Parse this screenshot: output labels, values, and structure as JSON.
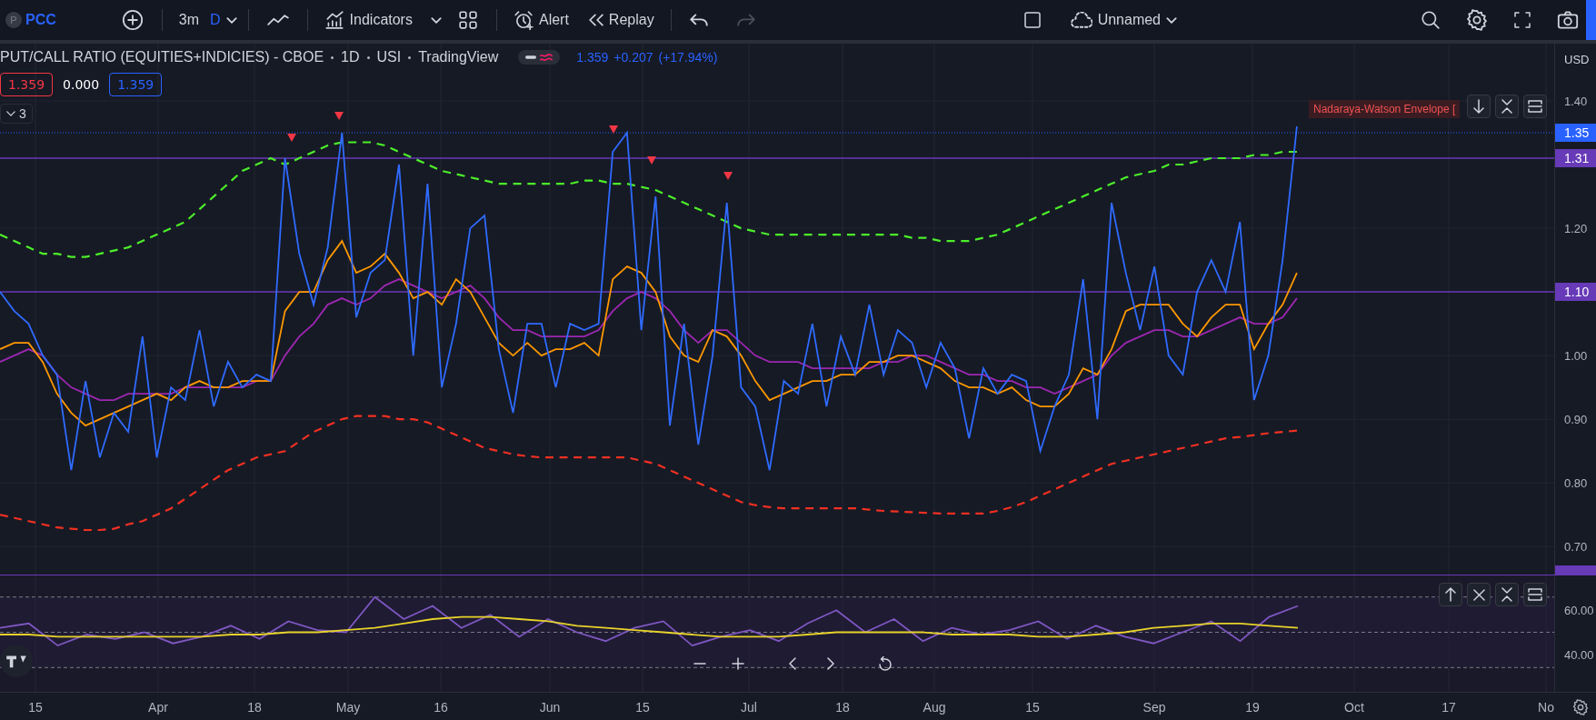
{
  "toolbar": {
    "symbol_initial": "P",
    "symbol": "PCC",
    "interval": "3m",
    "interval_unit": "D",
    "indicators": "Indicators",
    "alert": "Alert",
    "replay": "Replay",
    "redo_disabled": true,
    "layout_name": "Unnamed"
  },
  "legend": {
    "title": "PUT/CALL RATIO (EQUITIES+INDICIES) - CBOE",
    "interval": "1D",
    "exchange": "USI",
    "source": "TradingView",
    "visible": true,
    "last": "1.359",
    "change": "+0.207",
    "change_percent": "(+17.94%)",
    "values": [
      {
        "text": "1.359",
        "color": "#f23645"
      },
      {
        "text": "0.000"
      },
      {
        "text": "1.359",
        "color": "#2962ff"
      }
    ],
    "collapse_count": "3"
  },
  "indicator_label": "Nadaraya-Watson Envelope [",
  "axis_currency": "USD",
  "time_axis": [
    "15",
    "Apr",
    "18",
    "May",
    "16",
    "Jun",
    "15",
    "Jul",
    "18",
    "Aug",
    "15",
    "Sep",
    "19",
    "Oct",
    "17",
    "No"
  ],
  "main": {
    "signal_markers": [
      {
        "kind": "triangle"
      },
      {
        "kind": "triangle"
      },
      {
        "kind": "triangle"
      },
      {
        "kind": "triangle"
      },
      {
        "kind": "triangle"
      }
    ],
    "chart_data": {
      "type": "line",
      "grid": true,
      "ylim": [
        0.656,
        1.49
      ],
      "yticks": [
        {
          "value": 1.4,
          "label": "1.40"
        },
        {
          "value": 1.2,
          "label": "1.20"
        },
        {
          "value": 1.0,
          "label": "1.00"
        },
        {
          "value": 0.9,
          "label": "0.90"
        },
        {
          "value": 0.8,
          "label": "0.80"
        },
        {
          "value": 0.7,
          "label": "0.70"
        }
      ],
      "series": [
        {
          "color": "#4cef2a",
          "line_style": "dashed",
          "values": [
            1.19,
            1.18,
            1.17,
            1.16,
            1.16,
            1.155,
            1.155,
            1.16,
            1.165,
            1.17,
            1.18,
            1.19,
            1.2,
            1.21,
            1.23,
            1.25,
            1.27,
            1.29,
            1.3,
            1.31,
            1.3,
            1.31,
            1.32,
            1.33,
            1.335,
            1.335,
            1.335,
            1.33,
            1.32,
            1.31,
            1.3,
            1.29,
            1.285,
            1.28,
            1.275,
            1.27,
            1.27,
            1.27,
            1.27,
            1.27,
            1.27,
            1.275,
            1.275,
            1.27,
            1.27,
            1.265,
            1.26,
            1.25,
            1.24,
            1.23,
            1.22,
            1.21,
            1.2,
            1.195,
            1.19,
            1.19,
            1.19,
            1.19,
            1.19,
            1.19,
            1.19,
            1.19,
            1.19,
            1.19,
            1.185,
            1.185,
            1.18,
            1.18,
            1.18,
            1.185,
            1.19,
            1.2,
            1.21,
            1.22,
            1.23,
            1.24,
            1.25,
            1.26,
            1.27,
            1.28,
            1.285,
            1.29,
            1.3,
            1.3,
            1.305,
            1.31,
            1.31,
            1.31,
            1.315,
            1.315,
            1.32,
            1.32
          ]
        },
        {
          "color": "#f23022",
          "line_style": "dashed",
          "values": [
            0.75,
            0.745,
            0.74,
            0.735,
            0.73,
            0.728,
            0.726,
            0.726,
            0.728,
            0.735,
            0.74,
            0.75,
            0.76,
            0.775,
            0.79,
            0.805,
            0.82,
            0.83,
            0.84,
            0.845,
            0.85,
            0.865,
            0.88,
            0.89,
            0.9,
            0.905,
            0.905,
            0.905,
            0.9,
            0.9,
            0.895,
            0.885,
            0.875,
            0.865,
            0.855,
            0.85,
            0.845,
            0.842,
            0.84,
            0.84,
            0.84,
            0.84,
            0.84,
            0.84,
            0.84,
            0.835,
            0.83,
            0.82,
            0.81,
            0.8,
            0.79,
            0.78,
            0.77,
            0.765,
            0.762,
            0.76,
            0.76,
            0.76,
            0.76,
            0.76,
            0.76,
            0.758,
            0.756,
            0.755,
            0.754,
            0.753,
            0.752,
            0.752,
            0.752,
            0.752,
            0.756,
            0.762,
            0.77,
            0.78,
            0.79,
            0.8,
            0.81,
            0.82,
            0.83,
            0.835,
            0.84,
            0.845,
            0.85,
            0.855,
            0.86,
            0.865,
            0.87,
            0.872,
            0.875,
            0.878,
            0.88,
            0.882
          ]
        },
        {
          "color": "#9c27b0",
          "line_style": "solid",
          "values": [
            0.99,
            1.0,
            1.01,
            1.0,
            0.97,
            0.95,
            0.94,
            0.93,
            0.93,
            0.94,
            0.94,
            0.94,
            0.94,
            0.95,
            0.95,
            0.95,
            0.95,
            0.95,
            0.96,
            0.96,
            1.0,
            1.03,
            1.05,
            1.08,
            1.09,
            1.08,
            1.09,
            1.11,
            1.12,
            1.11,
            1.1,
            1.09,
            1.1,
            1.11,
            1.09,
            1.06,
            1.04,
            1.04,
            1.03,
            1.03,
            1.03,
            1.03,
            1.04,
            1.07,
            1.09,
            1.1,
            1.09,
            1.07,
            1.04,
            1.02,
            1.04,
            1.04,
            1.02,
            1.0,
            0.99,
            0.99,
            0.99,
            0.98,
            0.98,
            0.98,
            0.98,
            0.98,
            0.99,
            0.99,
            1.0,
            1.0,
            0.99,
            0.98,
            0.97,
            0.97,
            0.96,
            0.96,
            0.95,
            0.95,
            0.94,
            0.95,
            0.96,
            0.97,
            1.0,
            1.02,
            1.03,
            1.04,
            1.04,
            1.03,
            1.03,
            1.04,
            1.05,
            1.06,
            1.05,
            1.05,
            1.06,
            1.09
          ]
        },
        {
          "color": "#ff9800",
          "line_style": "solid",
          "values": [
            1.01,
            1.02,
            1.02,
            0.99,
            0.94,
            0.91,
            0.89,
            0.9,
            0.91,
            0.92,
            0.93,
            0.94,
            0.93,
            0.95,
            0.96,
            0.95,
            0.95,
            0.96,
            0.96,
            0.96,
            1.07,
            1.1,
            1.1,
            1.15,
            1.18,
            1.13,
            1.14,
            1.16,
            1.13,
            1.09,
            1.1,
            1.08,
            1.12,
            1.1,
            1.06,
            1.02,
            1.0,
            1.02,
            1.0,
            1.01,
            1.01,
            1.02,
            1.0,
            1.12,
            1.14,
            1.13,
            1.1,
            1.03,
            1.0,
            0.99,
            1.04,
            1.03,
            1.0,
            0.96,
            0.93,
            0.94,
            0.95,
            0.96,
            0.96,
            0.97,
            0.97,
            0.99,
            0.99,
            1.0,
            1.0,
            0.99,
            0.98,
            0.96,
            0.95,
            0.95,
            0.94,
            0.95,
            0.93,
            0.92,
            0.92,
            0.94,
            0.98,
            0.97,
            1.01,
            1.07,
            1.08,
            1.08,
            1.08,
            1.05,
            1.03,
            1.06,
            1.08,
            1.08,
            1.01,
            1.05,
            1.08,
            1.13
          ]
        },
        {
          "color": "#2f6bff",
          "line_style": "solid",
          "values": [
            1.1,
            1.07,
            1.05,
            1.0,
            0.97,
            0.82,
            0.96,
            0.84,
            0.91,
            0.88,
            1.03,
            0.84,
            0.95,
            0.93,
            1.04,
            0.92,
            0.99,
            0.95,
            0.97,
            0.96,
            1.31,
            1.16,
            1.08,
            1.17,
            1.35,
            1.06,
            1.13,
            1.15,
            1.3,
            1.0,
            1.27,
            0.95,
            1.05,
            1.2,
            1.22,
            1.01,
            0.91,
            1.05,
            1.05,
            0.95,
            1.05,
            1.04,
            1.05,
            1.32,
            1.35,
            1.04,
            1.25,
            0.89,
            1.05,
            0.86,
            1.0,
            1.24,
            0.95,
            0.92,
            0.82,
            0.96,
            0.94,
            1.05,
            0.92,
            1.03,
            0.97,
            1.08,
            0.97,
            1.04,
            1.02,
            0.95,
            1.02,
            0.98,
            0.87,
            0.98,
            0.94,
            0.97,
            0.96,
            0.85,
            0.92,
            0.97,
            1.12,
            0.9,
            1.24,
            1.13,
            1.04,
            1.14,
            1.0,
            0.97,
            1.1,
            1.15,
            1.1,
            1.21,
            0.93,
            1.0,
            1.15,
            1.36
          ]
        }
      ],
      "ref_lines": [
        {
          "axis": "y",
          "value": 1.35,
          "label": "1.35",
          "color": "#2962ff",
          "line_style": "dotted"
        },
        {
          "axis": "y",
          "value": 1.31,
          "label": "1.31",
          "color": "#673ab7",
          "line_style": "solid"
        },
        {
          "axis": "y",
          "value": 1.1,
          "label": "1.10",
          "color": "#673ab7",
          "line_style": "solid"
        }
      ]
    }
  },
  "oscillator": {
    "chart_data": {
      "type": "line",
      "grid": true,
      "ylim": [
        23,
        75.8
      ],
      "yticks": [
        {
          "value": 60,
          "label": "60.00"
        },
        {
          "value": 40,
          "label": "40.00"
        }
      ],
      "series": [
        {
          "color": "#7e57c2",
          "values": [
            52,
            54,
            44,
            49,
            47,
            50,
            45,
            48,
            53,
            47,
            55,
            51,
            50,
            66,
            56,
            62,
            52,
            58,
            48,
            56,
            50,
            46,
            52,
            55,
            44,
            48,
            51,
            46,
            54,
            60,
            50,
            56,
            46,
            52,
            49,
            51,
            55,
            47,
            53,
            48,
            45,
            50,
            55,
            46,
            57,
            62
          ]
        },
        {
          "color": "#e8d32a",
          "values": [
            49,
            49,
            48,
            48,
            48,
            48,
            48,
            48,
            49,
            49,
            50,
            50,
            51,
            52,
            54,
            56,
            57,
            57,
            56,
            55,
            53,
            52,
            51,
            50,
            49,
            48,
            48,
            48,
            49,
            50,
            50,
            50,
            50,
            49,
            49,
            49,
            48,
            48,
            49,
            50,
            52,
            53,
            54,
            54,
            53,
            52
          ]
        }
      ]
    }
  }
}
